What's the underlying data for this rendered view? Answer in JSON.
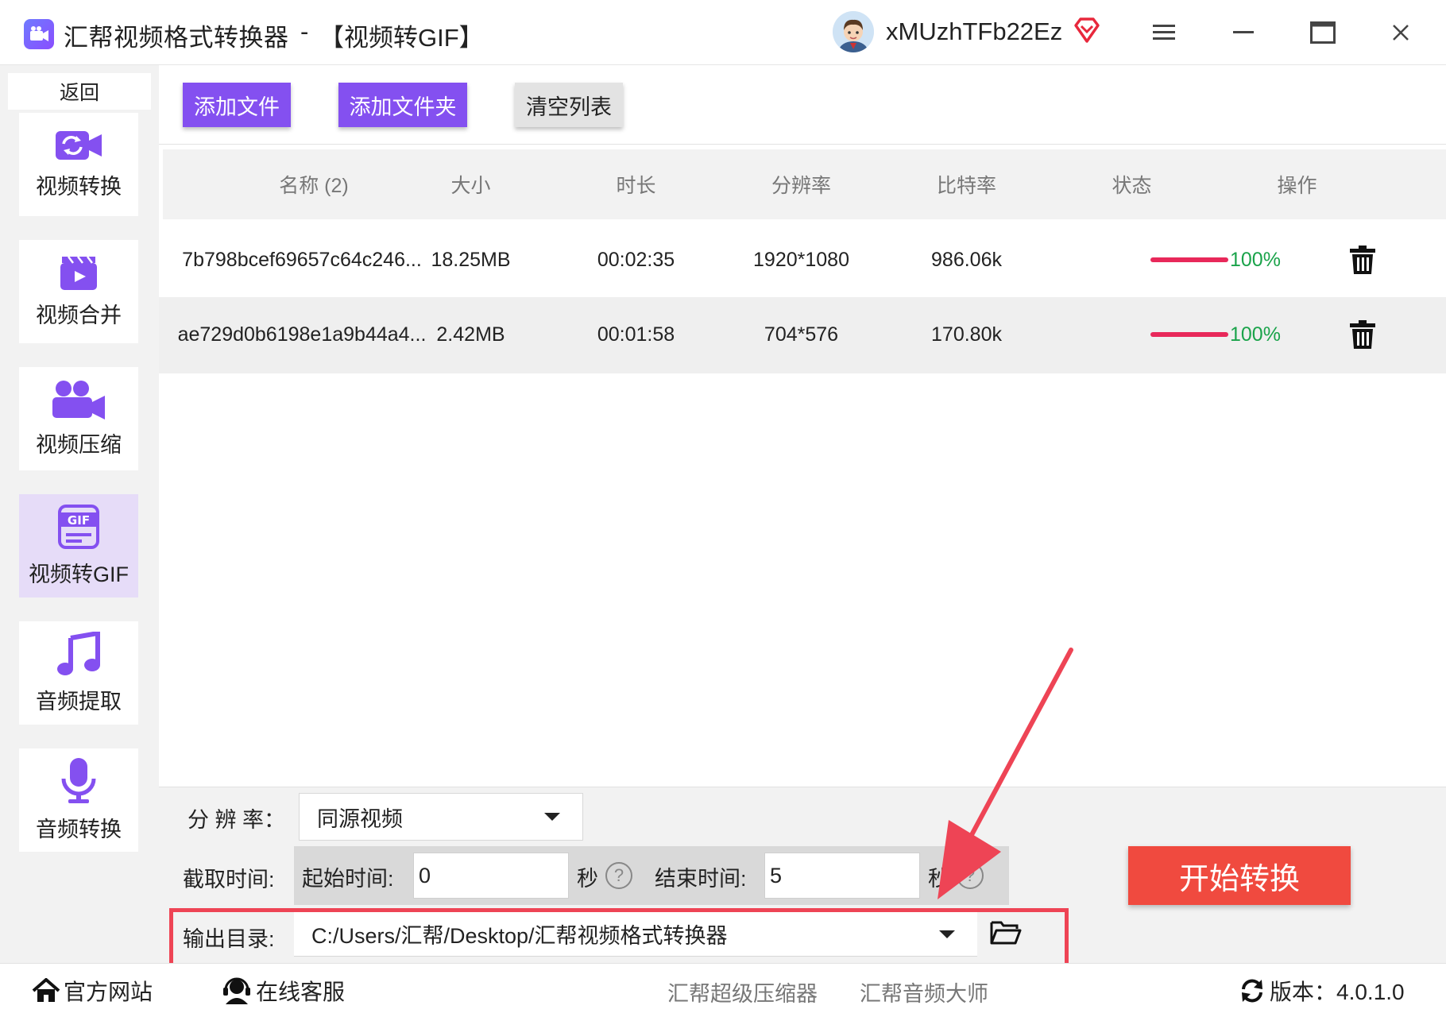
{
  "titlebar": {
    "app_name": "汇帮视频格式转换器",
    "separator": "-",
    "mode": "【视频转GIF】",
    "username": "xMUzhTFb22Ez"
  },
  "sidebar": {
    "back": "返回",
    "items": [
      {
        "label": "视频转换",
        "icon": "video-convert-icon",
        "active": false
      },
      {
        "label": "视频合并",
        "icon": "video-merge-icon",
        "active": false
      },
      {
        "label": "视频压缩",
        "icon": "video-compress-icon",
        "active": false
      },
      {
        "label": "视频转GIF",
        "icon": "gif-icon",
        "active": true
      },
      {
        "label": "音频提取",
        "icon": "music-note-icon",
        "active": false
      },
      {
        "label": "音频转换",
        "icon": "microphone-icon",
        "active": false
      }
    ]
  },
  "toolbar": {
    "add_file": "添加文件",
    "add_folder": "添加文件夹",
    "clear_list": "清空列表"
  },
  "table": {
    "headers": [
      "名称 (2)",
      "大小",
      "时长",
      "分辨率",
      "比特率",
      "状态",
      "操作"
    ],
    "rows": [
      {
        "name": "7b798bcef69657c64c246...",
        "size": "18.25MB",
        "duration": "00:02:35",
        "resolution": "1920*1080",
        "bitrate": "986.06k",
        "progress": 1.0,
        "status": "100%"
      },
      {
        "name": "ae729d0b6198e1a9b44a4...",
        "size": "2.42MB",
        "duration": "00:01:58",
        "resolution": "704*576",
        "bitrate": "170.80k",
        "progress": 1.0,
        "status": "100%"
      }
    ]
  },
  "settings": {
    "resolution_label": "分 辨 率：",
    "resolution_value": "同源视频",
    "clip_label": "截取时间:",
    "start_label": "起始时间:",
    "start_value": "0",
    "start_unit": "秒",
    "end_label": "结束时间:",
    "end_value": "5",
    "end_unit": "秒",
    "output_label": "输出目录:",
    "output_path": "C:/Users/汇帮/Desktop/汇帮视频格式转换器",
    "start_button": "开始转换"
  },
  "footer": {
    "website": "官方网站",
    "support": "在线客服",
    "link1": "汇帮超级压缩器",
    "link2": "汇帮音频大师",
    "version": "版本：4.0.1.0"
  },
  "colors": {
    "accent": "#8450f0",
    "start_button": "#f04a3f",
    "progress": "#e8285a",
    "status_text": "#1aa34a",
    "highlight": "#ee4455"
  }
}
